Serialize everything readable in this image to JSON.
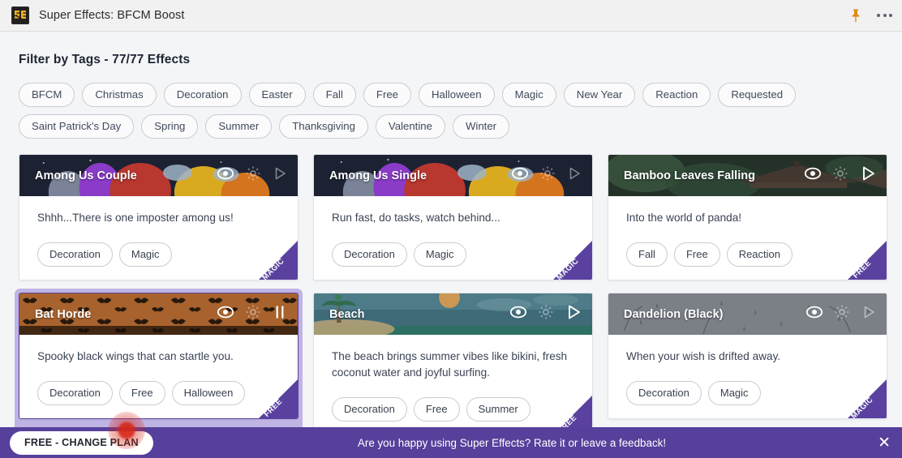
{
  "window": {
    "title": "Super Effects: BFCM Boost",
    "app_icon": "super-effects-logo",
    "pin_icon": "pin-icon",
    "more_icon": "more-options-icon"
  },
  "filter": {
    "heading": "Filter by Tags - 77/77 Effects",
    "tags": [
      "BFCM",
      "Christmas",
      "Decoration",
      "Easter",
      "Fall",
      "Free",
      "Halloween",
      "Magic",
      "New Year",
      "Reaction",
      "Requested",
      "Saint Patrick's Day",
      "Spring",
      "Summer",
      "Thanksgiving",
      "Valentine",
      "Winter"
    ]
  },
  "cards": [
    {
      "title": "Among Us Couple",
      "description": "Shhh...There is one imposter among us!",
      "tags": [
        "Decoration",
        "Magic"
      ],
      "ribbon": "MAGIC",
      "playing": false,
      "selected": false,
      "play_state": "play",
      "play_dim": true,
      "thumb": "among-us-space"
    },
    {
      "title": "Among Us Single",
      "description": "Run fast, do tasks, watch behind...",
      "tags": [
        "Decoration",
        "Magic"
      ],
      "ribbon": "MAGIC",
      "playing": false,
      "selected": false,
      "play_state": "play",
      "play_dim": true,
      "thumb": "among-us-space"
    },
    {
      "title": "Bamboo Leaves Falling",
      "description": "Into the world of panda!",
      "tags": [
        "Fall",
        "Free",
        "Reaction"
      ],
      "ribbon": "FREE",
      "playing": false,
      "selected": false,
      "play_state": "play",
      "play_dim": false,
      "thumb": "bamboo-green"
    },
    {
      "title": "Bat Horde",
      "description": "Spooky black wings that can startle you.",
      "tags": [
        "Decoration",
        "Free",
        "Halloween"
      ],
      "ribbon": "FREE",
      "playing": true,
      "selected": true,
      "play_state": "pause",
      "play_dim": false,
      "thumb": "bats-orange"
    },
    {
      "title": "Beach",
      "description": "The beach brings summer vibes like bikini, fresh coconut water and joyful surfing.",
      "tags": [
        "Decoration",
        "Free",
        "Summer"
      ],
      "ribbon": "FREE",
      "playing": false,
      "selected": false,
      "play_state": "play",
      "play_dim": false,
      "thumb": "beach-teal"
    },
    {
      "title": "Dandelion (Black)",
      "description": "When your wish is drifted away.",
      "tags": [
        "Decoration",
        "Magic"
      ],
      "ribbon": "MAGIC",
      "playing": false,
      "selected": false,
      "play_state": "play",
      "play_dim": true,
      "thumb": "dandelion-gray"
    }
  ],
  "card_icons": {
    "preview": "eye-icon",
    "settings": "gear-icon",
    "play": "play-icon",
    "pause": "pause-icon"
  },
  "bottom_bar": {
    "plan_label": "FREE - CHANGE PLAN",
    "feedback_text": "Are you happy using Super Effects? Rate it or leave a feedback!",
    "close_label": "✕"
  },
  "colors": {
    "accent_purple": "#56409b",
    "ribbon_purple": "#5a41a0",
    "selection_glow": "#967ed6",
    "pin_orange": "#e08c12",
    "logo_gold": "#f0b323",
    "click_marker_red": "#d62718"
  }
}
